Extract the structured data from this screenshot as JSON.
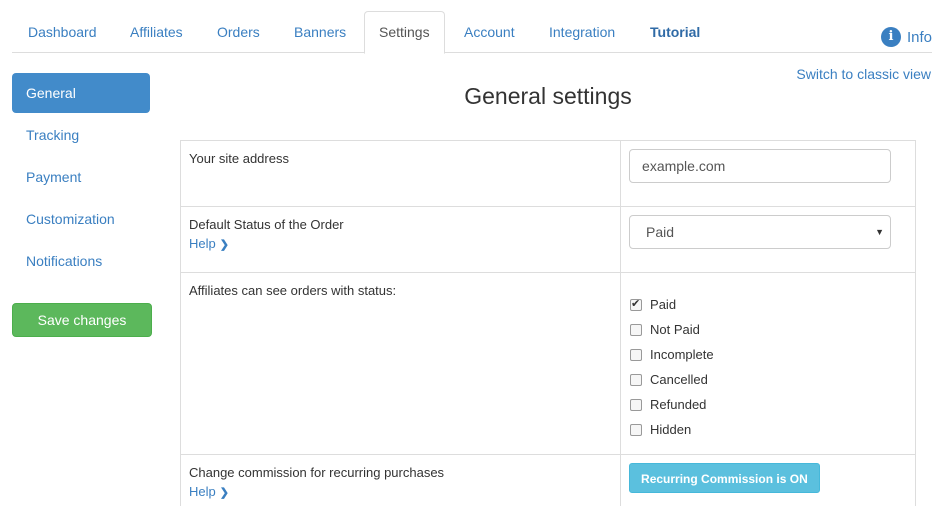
{
  "tabs": [
    {
      "label": "Dashboard"
    },
    {
      "label": "Affiliates"
    },
    {
      "label": "Orders"
    },
    {
      "label": "Banners"
    },
    {
      "label": "Settings",
      "active": true
    },
    {
      "label": "Account"
    },
    {
      "label": "Integration"
    },
    {
      "label": "Tutorial",
      "bold": true
    }
  ],
  "info": {
    "label": "Info",
    "icon": "info-icon"
  },
  "sidebar": {
    "items": [
      {
        "label": "General",
        "active": true
      },
      {
        "label": "Tracking"
      },
      {
        "label": "Payment"
      },
      {
        "label": "Customization"
      },
      {
        "label": "Notifications"
      }
    ],
    "save_label": "Save changes"
  },
  "classic_link": "Switch to classic view",
  "page_title": "General settings",
  "settings": {
    "site_address": {
      "label": "Your site address",
      "value": "example.com"
    },
    "default_status": {
      "label": "Default Status of the Order",
      "help": "Help",
      "selected": "Paid"
    },
    "visible_statuses": {
      "label": "Affiliates can see orders with status:",
      "options": [
        {
          "label": "Paid",
          "checked": true
        },
        {
          "label": "Not Paid",
          "checked": false
        },
        {
          "label": "Incomplete",
          "checked": false
        },
        {
          "label": "Cancelled",
          "checked": false
        },
        {
          "label": "Refunded",
          "checked": false
        },
        {
          "label": "Hidden",
          "checked": false
        }
      ]
    },
    "recurring": {
      "label": "Change commission for recurring purchases",
      "help": "Help",
      "button": "Recurring Commission is ON"
    }
  },
  "colors": {
    "accent": "#428bca",
    "link": "#3a7fc1",
    "success": "#5cb85c",
    "info": "#5bc0de"
  }
}
